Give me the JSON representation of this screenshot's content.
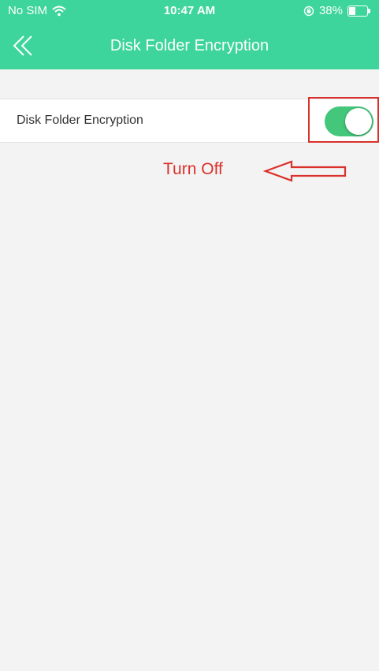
{
  "status_bar": {
    "carrier": "No SIM",
    "time": "10:47 AM",
    "battery_text": "38%",
    "battery_level": 0.38
  },
  "nav": {
    "back_icon": "double-chevron-left-icon",
    "title": "Disk Folder Encryption"
  },
  "setting": {
    "label": "Disk Folder Encryption",
    "enabled": true
  },
  "annotation": {
    "text": "Turn Off",
    "color": "#d9312b"
  },
  "colors": {
    "header": "#3dd59b",
    "toggle_on": "#44c77a",
    "background": "#f3f3f3"
  }
}
